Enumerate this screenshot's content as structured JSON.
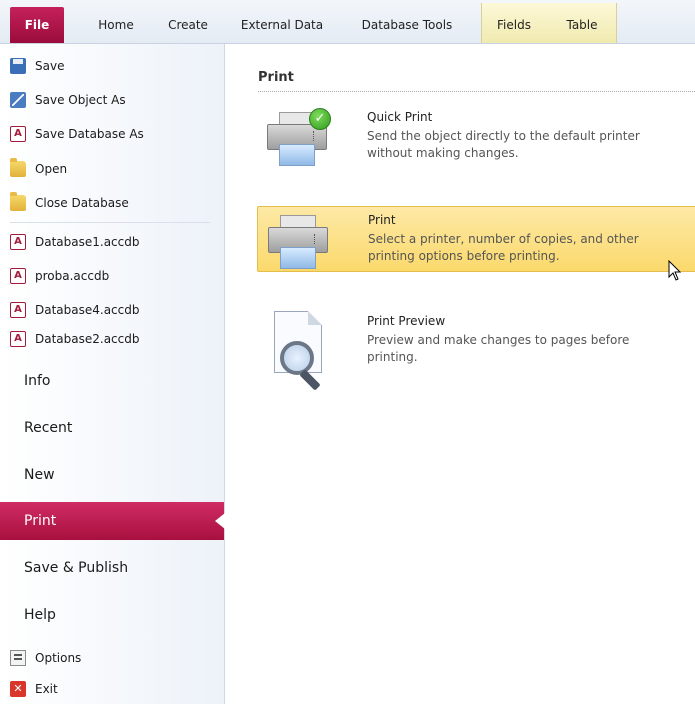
{
  "ribbon": {
    "tabs": [
      "File",
      "Home",
      "Create",
      "External Data",
      "Database Tools",
      "Fields",
      "Table"
    ]
  },
  "backstage": {
    "commands": [
      {
        "label": "Save",
        "icon": "save-icon"
      },
      {
        "label": "Save Object As",
        "icon": "save-object-icon"
      },
      {
        "label": "Save Database As",
        "icon": "access-db-icon"
      },
      {
        "label": "Open",
        "icon": "open-folder-icon"
      },
      {
        "label": "Close Database",
        "icon": "folder-icon"
      }
    ],
    "recent_files": [
      "Database1.accdb",
      "proba.accdb",
      "Database4.accdb",
      "Database2.accdb"
    ],
    "sections": [
      "Info",
      "Recent",
      "New",
      "Print",
      "Save & Publish",
      "Help"
    ],
    "active_section": "Print",
    "bottom_commands": [
      {
        "label": "Options",
        "icon": "options-icon"
      },
      {
        "label": "Exit",
        "icon": "exit-icon"
      }
    ]
  },
  "main": {
    "heading": "Print",
    "options": [
      {
        "title": "Quick Print",
        "description": "Send the object directly to the default printer without making changes."
      },
      {
        "title": "Print",
        "description": "Select a printer, number of copies, and other printing options before printing."
      },
      {
        "title": "Print Preview",
        "description": "Preview and make changes to pages before printing."
      }
    ]
  },
  "colors": {
    "accent": "#b3174a",
    "highlight": "#fbd96c"
  }
}
